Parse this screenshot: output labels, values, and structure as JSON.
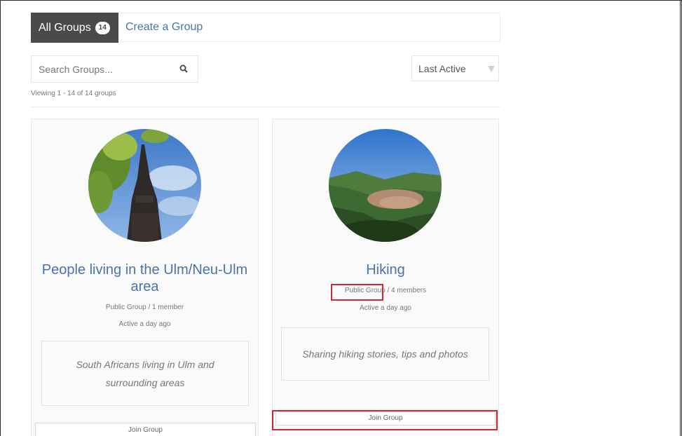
{
  "tabs": {
    "all_groups_label": "All Groups",
    "all_groups_count": "14",
    "create_label": "Create a Group"
  },
  "search": {
    "placeholder": "Search Groups..."
  },
  "sort": {
    "selected": "Last Active"
  },
  "viewing_text": "Viewing 1 - 14 of 14 groups",
  "groups": [
    {
      "title": "People living in the Ulm/Neu-Ulm area",
      "meta_type": "Public Group / 1 member",
      "active": "Active a day ago",
      "description": "South Africans living in Ulm and surrounding areas",
      "join_label": "Join Group"
    },
    {
      "title": "Hiking",
      "meta_type_label": "Public Group",
      "meta_members": " / 4 members",
      "active": "Active a day ago",
      "description": "Sharing hiking stories, tips and photos",
      "join_label": "Join Group"
    }
  ],
  "colors": {
    "accent": "#4a74a8",
    "tab_active_bg": "#4a4a4a",
    "highlight": "#d22630"
  },
  "icons": {
    "search": "search-icon",
    "sort": "chevron-down-icon"
  }
}
